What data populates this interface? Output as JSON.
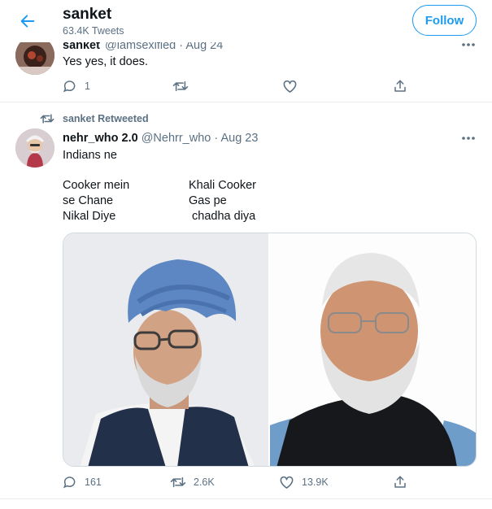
{
  "header": {
    "title": "sanket",
    "subtitle": "63.4K Tweets",
    "follow_label": "Follow"
  },
  "tweet1": {
    "name": "sanket",
    "handle": "@iamsexified",
    "date": "Aug 24",
    "text": "Yes yes, it does.",
    "reply_count": "1",
    "retweet_count": "",
    "like_count": ""
  },
  "tweet2": {
    "retweeted_by": "sanket Retweeted",
    "name": "nehr_who 2.0",
    "handle": "@Nehrr_who",
    "date": "Aug 23",
    "lines": {
      "intro": "Indians ne",
      "left1": "Cooker mein",
      "left2": "se Chane",
      "left3": "Nikal Diye",
      "right1": "Khali Cooker",
      "right2": "Gas pe",
      "right3": " chadha diya"
    },
    "reply_count": "161",
    "retweet_count": "2.6K",
    "like_count": "13.9K"
  },
  "colors": {
    "accent": "#1d9bf0",
    "secondary_text": "#5b7083",
    "border": "#e6ecf0"
  },
  "icons": {
    "back": "back-arrow-icon",
    "more": "more-dots-icon",
    "reply": "reply-icon",
    "retweet": "retweet-icon",
    "like": "heart-icon",
    "share": "share-icon"
  }
}
